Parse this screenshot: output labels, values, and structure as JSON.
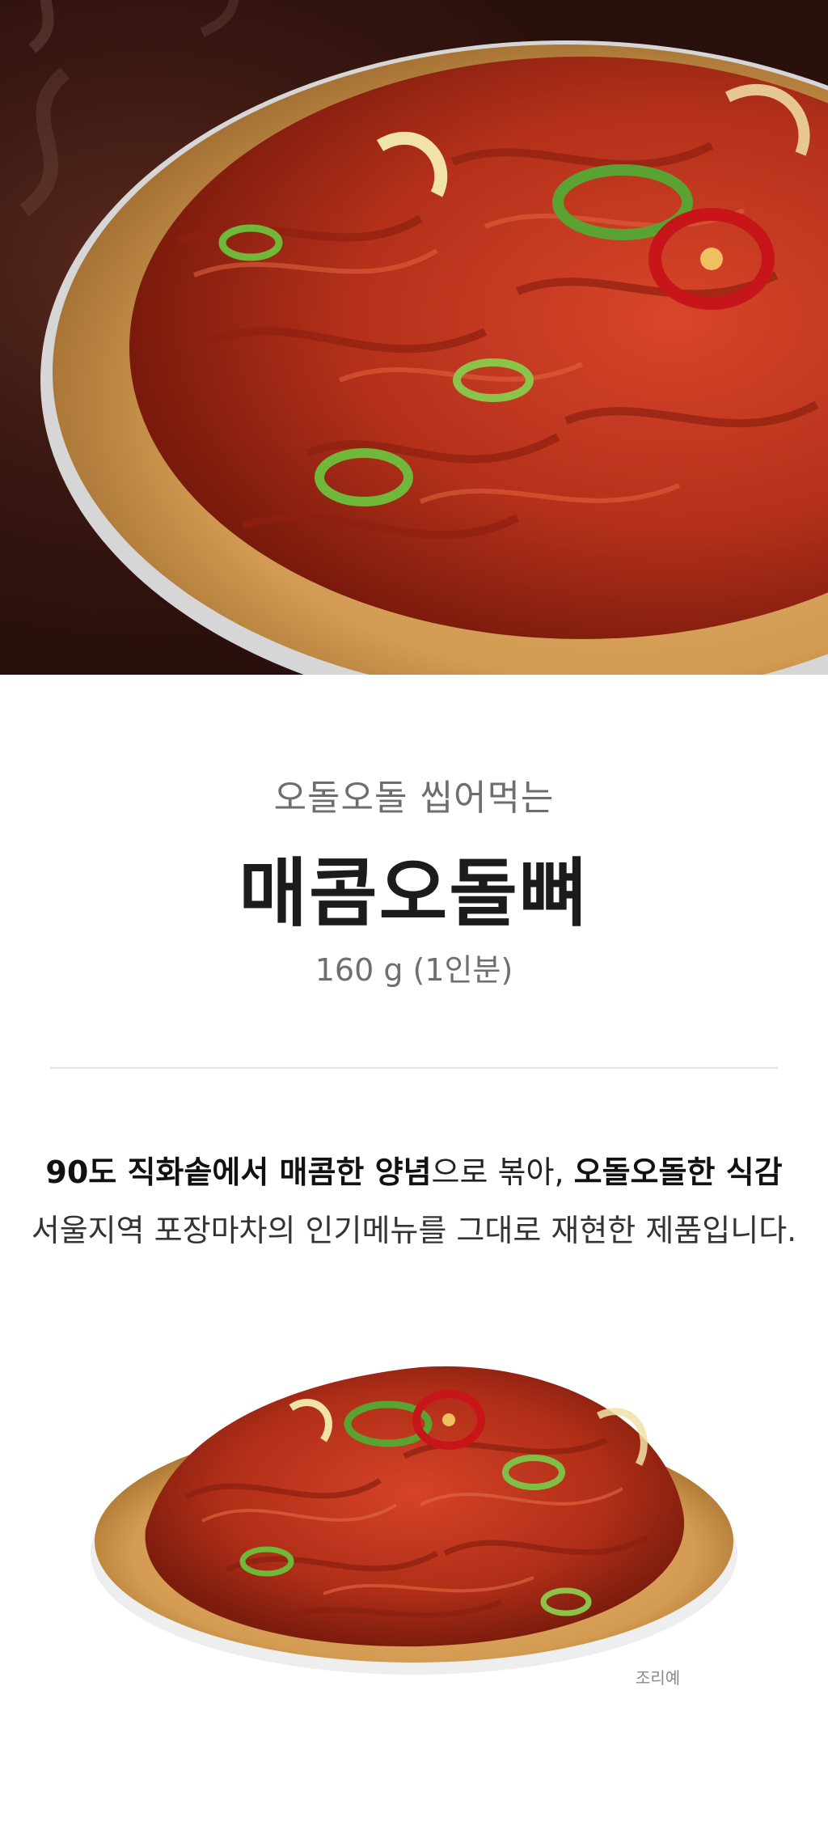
{
  "hero": {
    "image": "spicy-chewy-cartilage-dish-photo"
  },
  "product": {
    "subtitle": "오돌오돌 씹어먹는",
    "title": "매콤오돌뼈",
    "weight": "160 g (1인분)"
  },
  "description": {
    "line1": {
      "part1_bold": "90도 직화솥에서 매콤한 양념",
      "part2": "으로 볶아, ",
      "part3_bold": "오돌오돌한 식감"
    },
    "line2": "서울지역 포장마차의 인기메뉴를 그대로 재현한 제품입니다."
  },
  "serving_photo": {
    "caption": "조리예"
  },
  "colors": {
    "title": "#1c1c1c",
    "subtitle": "#6e6e6e",
    "sauce": "#c0321a",
    "plate": "#d9a55a",
    "background_dark": "#2a100c"
  }
}
